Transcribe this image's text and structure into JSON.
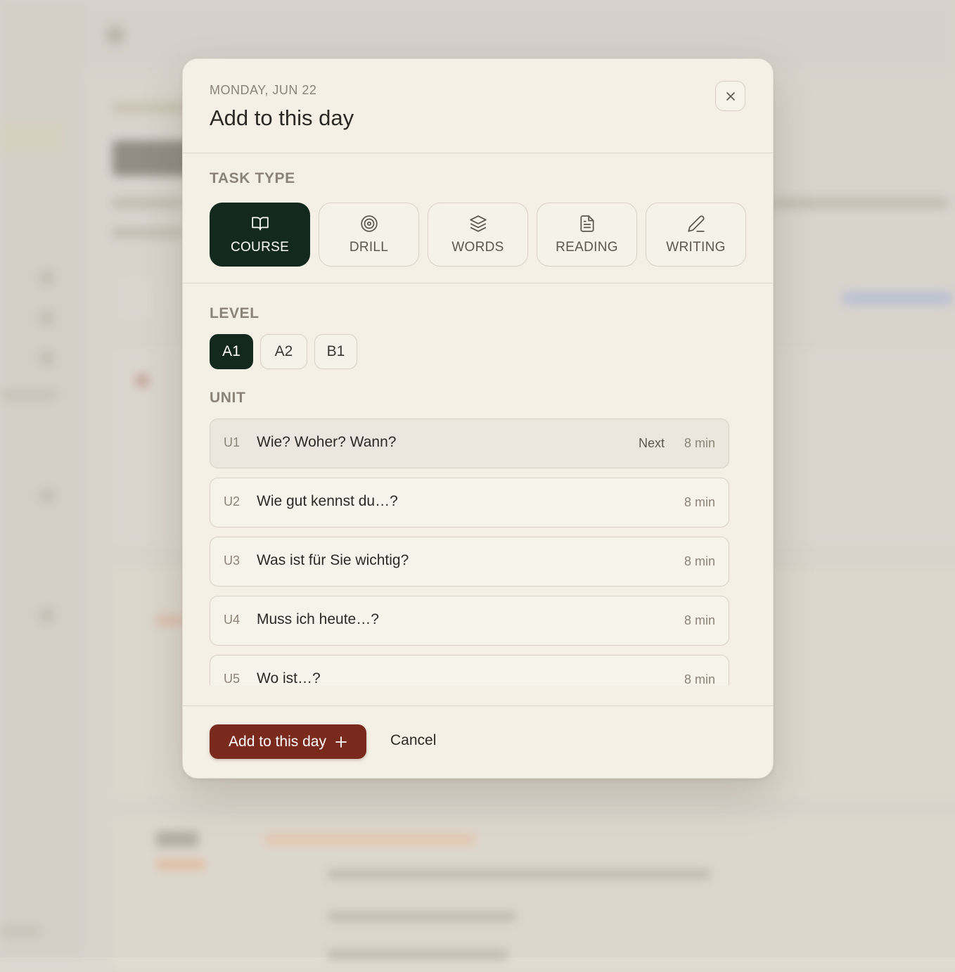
{
  "modal": {
    "date": "MONDAY, JUN 22",
    "title": "Add to this day",
    "task_type_label": "TASK TYPE",
    "task_types": [
      {
        "label": "COURSE",
        "icon": "book-open-icon",
        "selected": true
      },
      {
        "label": "DRILL",
        "icon": "target-icon",
        "selected": false
      },
      {
        "label": "WORDS",
        "icon": "layers-icon",
        "selected": false
      },
      {
        "label": "READING",
        "icon": "document-icon",
        "selected": false
      },
      {
        "label": "WRITING",
        "icon": "pen-icon",
        "selected": false
      }
    ],
    "level_label": "LEVEL",
    "levels": [
      {
        "label": "A1",
        "selected": true
      },
      {
        "label": "A2",
        "selected": false
      },
      {
        "label": "B1",
        "selected": false
      }
    ],
    "unit_label": "UNIT",
    "units": [
      {
        "code": "U1",
        "name": "Wie? Woher? Wann?",
        "badge": "Next",
        "duration": "8 min",
        "selected": true
      },
      {
        "code": "U2",
        "name": "Wie gut kennst du…?",
        "badge": "",
        "duration": "8 min",
        "selected": false
      },
      {
        "code": "U3",
        "name": "Was ist für Sie wichtig?",
        "badge": "",
        "duration": "8 min",
        "selected": false
      },
      {
        "code": "U4",
        "name": "Muss ich heute…?",
        "badge": "",
        "duration": "8 min",
        "selected": false
      },
      {
        "code": "U5",
        "name": "Wo ist…?",
        "badge": "",
        "duration": "8 min",
        "selected": false
      }
    ],
    "primary_button": "Add to this day",
    "cancel_button": "Cancel"
  },
  "colors": {
    "accent_dark": "#13291f",
    "primary_button": "#7a2a1d",
    "modal_background": "#f4f0e6"
  }
}
